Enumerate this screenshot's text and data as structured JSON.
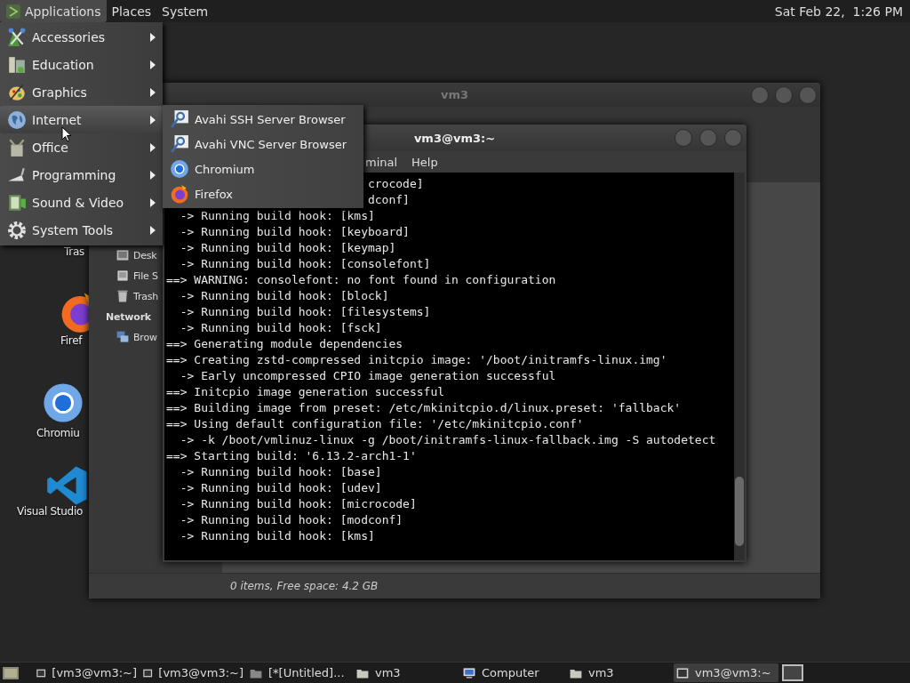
{
  "top_panel": {
    "menus": [
      {
        "label": "Applications",
        "selected": true
      },
      {
        "label": "Places",
        "selected": false
      },
      {
        "label": "System",
        "selected": false
      }
    ],
    "clock": "Sat Feb 22,  1:26 PM"
  },
  "desktop_icons": [
    {
      "label": "Tras",
      "kind": "hidden"
    },
    {
      "label": "Firef",
      "kind": "firefox"
    },
    {
      "label": "Chromiu",
      "kind": "chromium"
    },
    {
      "label": "Visual Studio",
      "kind": "vscode"
    }
  ],
  "file_manager": {
    "title": "vm3",
    "sidebar": [
      {
        "label": "Desk",
        "kind": "desktop"
      },
      {
        "label": "File S",
        "kind": "drive"
      },
      {
        "label": "Trash",
        "kind": "trash"
      },
      {
        "label": "Network",
        "kind": "heading"
      },
      {
        "label": "Brow",
        "kind": "network"
      }
    ],
    "status": "0 items, Free space: 4.2 GB"
  },
  "terminal": {
    "title": "vm3@vm3:~",
    "menus": [
      "minal",
      "Help"
    ],
    "lines": [
      {
        "text": "crocode]",
        "kind": "tail"
      },
      {
        "text": "dconf]",
        "kind": "tail"
      },
      {
        "text": "  -> Running build hook: [kms]",
        "kind": "full"
      },
      {
        "text": "  -> Running build hook: [keyboard]",
        "kind": "full"
      },
      {
        "text": "  -> Running build hook: [keymap]",
        "kind": "full"
      },
      {
        "text": "  -> Running build hook: [consolefont]",
        "kind": "full"
      },
      {
        "text": "==> WARNING: consolefont: no font found in configuration",
        "kind": "full"
      },
      {
        "text": "  -> Running build hook: [block]",
        "kind": "full"
      },
      {
        "text": "  -> Running build hook: [filesystems]",
        "kind": "full"
      },
      {
        "text": "  -> Running build hook: [fsck]",
        "kind": "full"
      },
      {
        "text": "==> Generating module dependencies",
        "kind": "full"
      },
      {
        "text": "==> Creating zstd-compressed initcpio image: '/boot/initramfs-linux.img'",
        "kind": "full"
      },
      {
        "text": "  -> Early uncompressed CPIO image generation successful",
        "kind": "full"
      },
      {
        "text": "==> Initcpio image generation successful",
        "kind": "full"
      },
      {
        "text": "==> Building image from preset: /etc/mkinitcpio.d/linux.preset: 'fallback'",
        "kind": "full"
      },
      {
        "text": "==> Using default configuration file: '/etc/mkinitcpio.conf'",
        "kind": "full"
      },
      {
        "text": "  -> -k /boot/vmlinuz-linux -g /boot/initramfs-linux-fallback.img -S autodetect",
        "kind": "full"
      },
      {
        "text": "==> Starting build: '6.13.2-arch1-1'",
        "kind": "full"
      },
      {
        "text": "  -> Running build hook: [base]",
        "kind": "full"
      },
      {
        "text": "  -> Running build hook: [udev]",
        "kind": "full"
      },
      {
        "text": "  -> Running build hook: [microcode]",
        "kind": "full"
      },
      {
        "text": "  -> Running build hook: [modconf]",
        "kind": "full"
      },
      {
        "text": "  -> Running build hook: [kms]",
        "kind": "full"
      }
    ]
  },
  "applications_menu": {
    "items": [
      {
        "label": "Accessories",
        "kind": "accessories",
        "selected": false
      },
      {
        "label": "Education",
        "kind": "education",
        "selected": false
      },
      {
        "label": "Graphics",
        "kind": "graphics",
        "selected": false
      },
      {
        "label": "Internet",
        "kind": "internet",
        "selected": true
      },
      {
        "label": "Office",
        "kind": "office",
        "selected": false
      },
      {
        "label": "Programming",
        "kind": "programming",
        "selected": false
      },
      {
        "label": "Sound & Video",
        "kind": "media",
        "selected": false
      },
      {
        "label": "System Tools",
        "kind": "system",
        "selected": false
      }
    ]
  },
  "internet_submenu": {
    "items": [
      {
        "label": "Avahi SSH Server Browser",
        "kind": "avahi"
      },
      {
        "label": "Avahi VNC Server Browser",
        "kind": "avahi"
      },
      {
        "label": "Chromium",
        "kind": "chromium"
      },
      {
        "label": "Firefox",
        "kind": "firefox"
      }
    ]
  },
  "taskbar": {
    "tasks": [
      {
        "label": "[vm3@vm3:~]",
        "kind": "terminal",
        "selected": false
      },
      {
        "label": "[vm3@vm3:~]",
        "kind": "terminal",
        "selected": false
      },
      {
        "label": "[*[Untitled]...",
        "kind": "editor",
        "selected": false
      },
      {
        "label": "vm3",
        "kind": "folder",
        "selected": false
      },
      {
        "label": "Computer",
        "kind": "computer",
        "selected": false
      },
      {
        "label": "vm3",
        "kind": "folder",
        "selected": false
      },
      {
        "label": "vm3@vm3:~",
        "kind": "terminal",
        "selected": true
      }
    ]
  }
}
